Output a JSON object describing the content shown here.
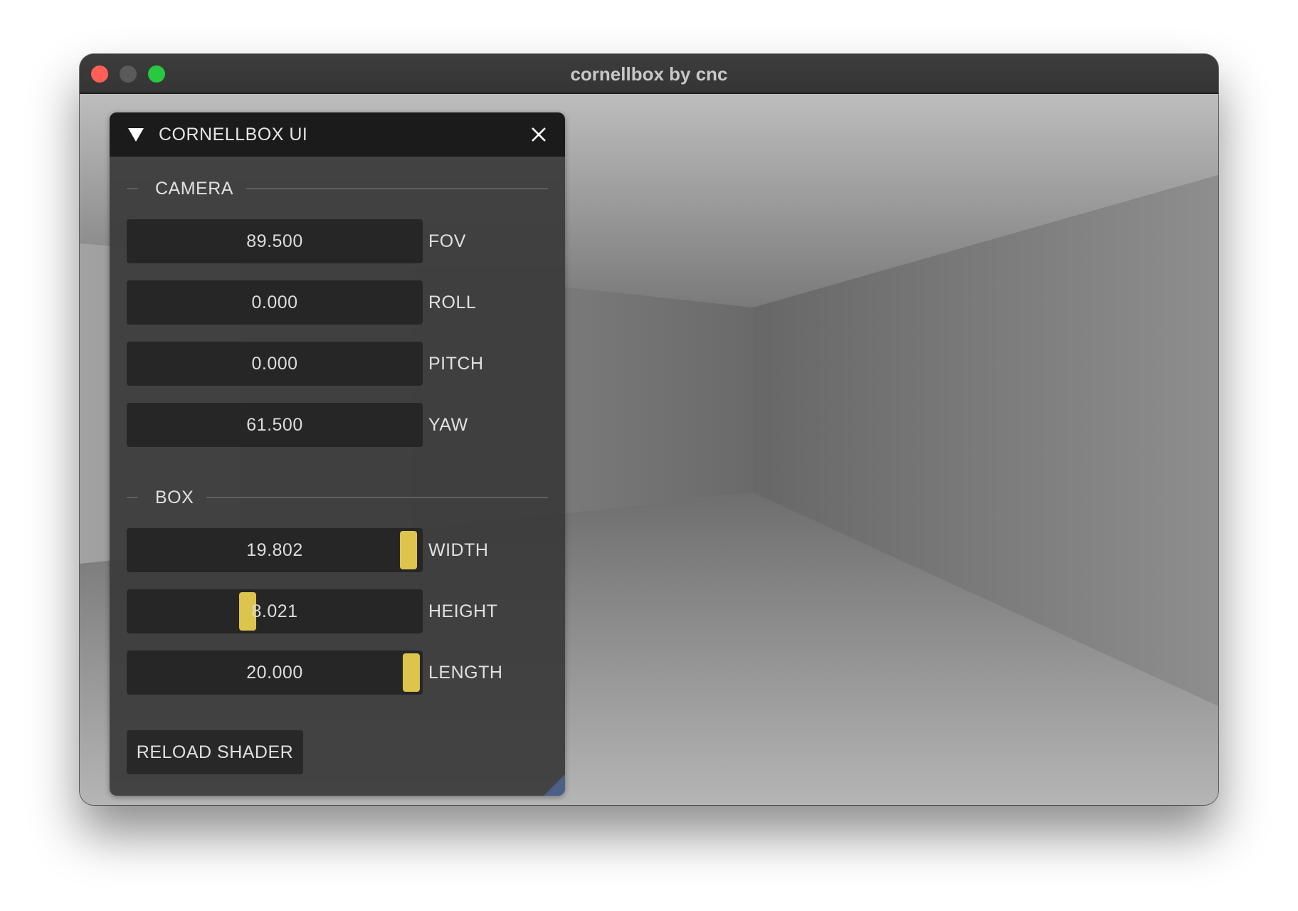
{
  "window": {
    "title": "cornellbox by cnc"
  },
  "panel": {
    "title": "CORNELLBOX UI",
    "sections": {
      "camera": "CAMERA",
      "box": "BOX"
    },
    "camera": {
      "fov": {
        "label": "FOV",
        "value": "89.500"
      },
      "roll": {
        "label": "ROLL",
        "value": "0.000"
      },
      "pitch": {
        "label": "PITCH",
        "value": "0.000"
      },
      "yaw": {
        "label": "YAW",
        "value": "61.500"
      }
    },
    "box": {
      "width": {
        "label": "WIDTH",
        "value": "19.802",
        "slider_fraction": 0.99
      },
      "height": {
        "label": "HEIGHT",
        "value": "8.021",
        "slider_fraction": 0.4
      },
      "length": {
        "label": "LENGTH",
        "value": "20.000",
        "slider_fraction": 1.0
      }
    },
    "reload_button": "RELOAD SHADER"
  },
  "colors": {
    "slider_grab": "#ddc44d",
    "close_traffic_light": "#ff5f57",
    "zoom_traffic_light": "#28c840"
  },
  "icons": {
    "collapse": "triangle-down-icon",
    "close": "close-x-icon"
  }
}
